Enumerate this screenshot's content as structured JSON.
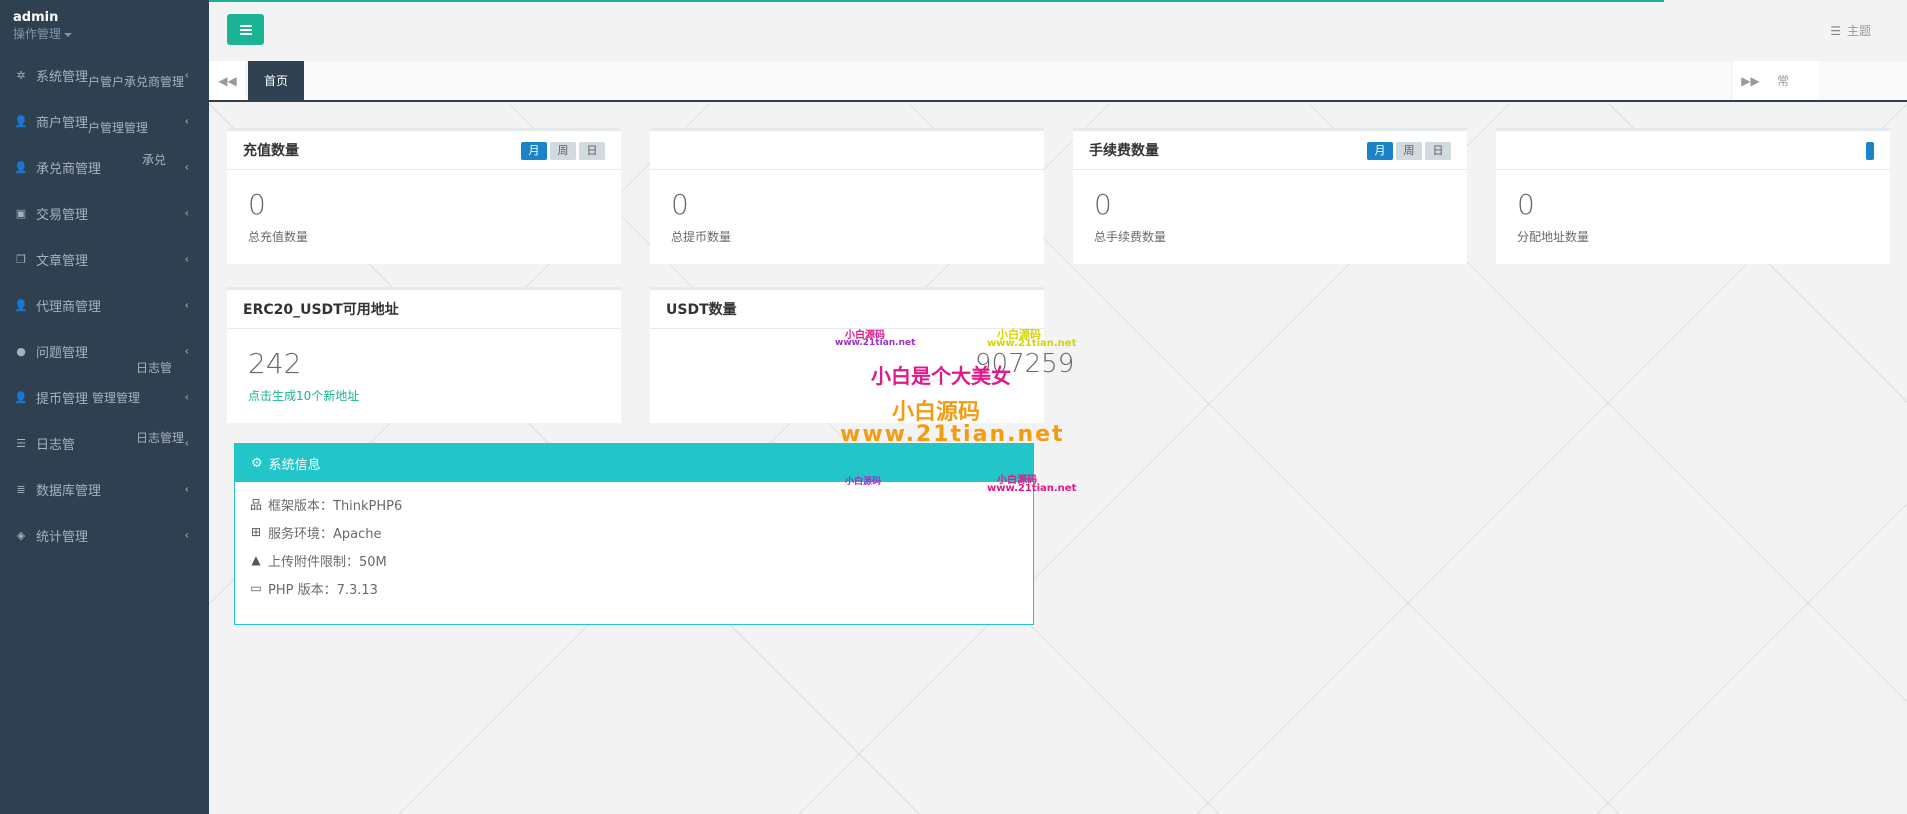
{
  "sidebar": {
    "user_name": "admin",
    "user_role": "操作管理",
    "items": [
      {
        "label": "系统管理",
        "icon": "gear-icon",
        "glyph": "✲",
        "ghost": "户管户承兑商管理"
      },
      {
        "label": "商户管理",
        "icon": "user-icon",
        "glyph": "👤",
        "ghost": "户管理管理"
      },
      {
        "label": "承兑商管理",
        "icon": "user-icon",
        "glyph": "👤",
        "ghost": "承兑"
      },
      {
        "label": "交易管理",
        "icon": "image-icon",
        "glyph": "▣",
        "ghost": ""
      },
      {
        "label": "文章管理",
        "icon": "copy-icon",
        "glyph": "❐",
        "ghost": ""
      },
      {
        "label": "代理商管理",
        "icon": "user-icon",
        "glyph": "👤",
        "ghost": ""
      },
      {
        "label": "问题管理",
        "icon": "comment-icon",
        "glyph": "●",
        "ghost": "日志管"
      },
      {
        "label": "提币管理",
        "icon": "user-icon",
        "glyph": "👤",
        "ghost": "管理管理"
      },
      {
        "label": "日志管",
        "icon": "list-icon",
        "glyph": "☰",
        "ghost": "日志管理"
      },
      {
        "label": "数据库管理",
        "icon": "database-icon",
        "glyph": "≣",
        "ghost": ""
      },
      {
        "label": "统计管理",
        "icon": "cube-icon",
        "glyph": "◈",
        "ghost": ""
      }
    ]
  },
  "topbar": {
    "theme_label": "主题"
  },
  "tabs": {
    "home_label": "首页",
    "close_label": "常"
  },
  "cards": [
    {
      "title": "充值数量",
      "value": "0",
      "label": "总充值数量",
      "pills": [
        "月",
        "周",
        "日"
      ]
    },
    {
      "title": "",
      "value": "0",
      "label": "总提币数量",
      "pills": []
    },
    {
      "title": "手续费数量",
      "value": "0",
      "label": "总手续费数量",
      "pills": [
        "月",
        "周",
        "日"
      ]
    },
    {
      "title": "",
      "value": "0",
      "label": "分配地址数量",
      "pills": []
    },
    {
      "title": "ERC20_USDT可用地址",
      "value": "242",
      "label": "点击生成10个新地址",
      "pills": []
    },
    {
      "title": "USDT数量",
      "value": "907259",
      "label": "",
      "pills": []
    }
  ],
  "system_info": {
    "title": "系统信息",
    "rows": [
      {
        "icon": "sitemap-icon",
        "glyph": "品",
        "text": "框架版本：ThinkPHP6"
      },
      {
        "icon": "windows-icon",
        "glyph": "⊞",
        "text": "服务环境：Apache"
      },
      {
        "icon": "warning-icon",
        "glyph": "▲",
        "text": "上传附件限制：50M"
      },
      {
        "icon": "card-icon",
        "glyph": "▭",
        "text": "PHP 版本：7.3.13"
      }
    ]
  },
  "watermarks": {
    "small_1": "小白源码",
    "url_1": "www.21tian.net",
    "main": "小白是个大美女",
    "brand": "小白源码",
    "url_main": "www.21tian.net"
  },
  "colors": {
    "sidebar_bg": "#2f4050",
    "primary": "#1ab394",
    "info": "#23c6c8",
    "pill_active": "#1c84c6"
  }
}
